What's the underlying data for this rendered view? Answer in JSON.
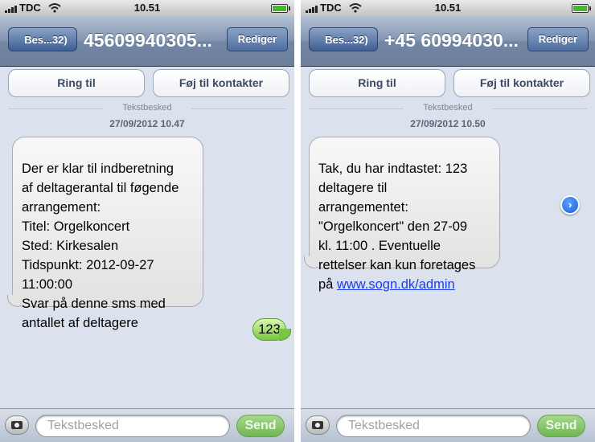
{
  "status": {
    "carrier": "TDC",
    "time": "10.51"
  },
  "nav": {
    "back_label": "Bes...32)",
    "edit_label": "Rediger"
  },
  "actions": {
    "call_label": "Ring til",
    "add_contact_label": "Føj til kontakter"
  },
  "conversation_left": {
    "title": "45609940305...",
    "label": "Tekstbesked",
    "date": "27/09/2012 10.47",
    "received_text": "Der er klar til indberetning\naf deltagerantal til føgende\narrangement:\n Titel: Orgelkoncert\n Sted: Kirkesalen\n Tidspunkt: 2012-09-27\n11:00:00\n Svar på denne sms med\nantallet af deltagere",
    "sent_text": "123"
  },
  "conversation_right": {
    "title": "+45 60994030...",
    "label": "Tekstbesked",
    "date": "27/09/2012 10.50",
    "received_text": "Tak, du har indtastet: 123\ndeltagere til\narrangementet:\n\"Orgelkoncert\" den 27-09\nkl. 11:00 . Eventuelle\nrettelser kan kun foretages\npå ",
    "link_text": "www.sogn.dk/admin"
  },
  "compose": {
    "placeholder": "Tekstbesked",
    "send_label": "Send"
  },
  "icons": [
    "signal-icon",
    "wifi-icon",
    "battery-icon",
    "camera-icon",
    "detail-arrow-icon"
  ],
  "colors": {
    "navbar": "#7387a5",
    "background": "#dbe2ed",
    "sent_bubble": "#76c541",
    "link": "#1a3cf0"
  }
}
